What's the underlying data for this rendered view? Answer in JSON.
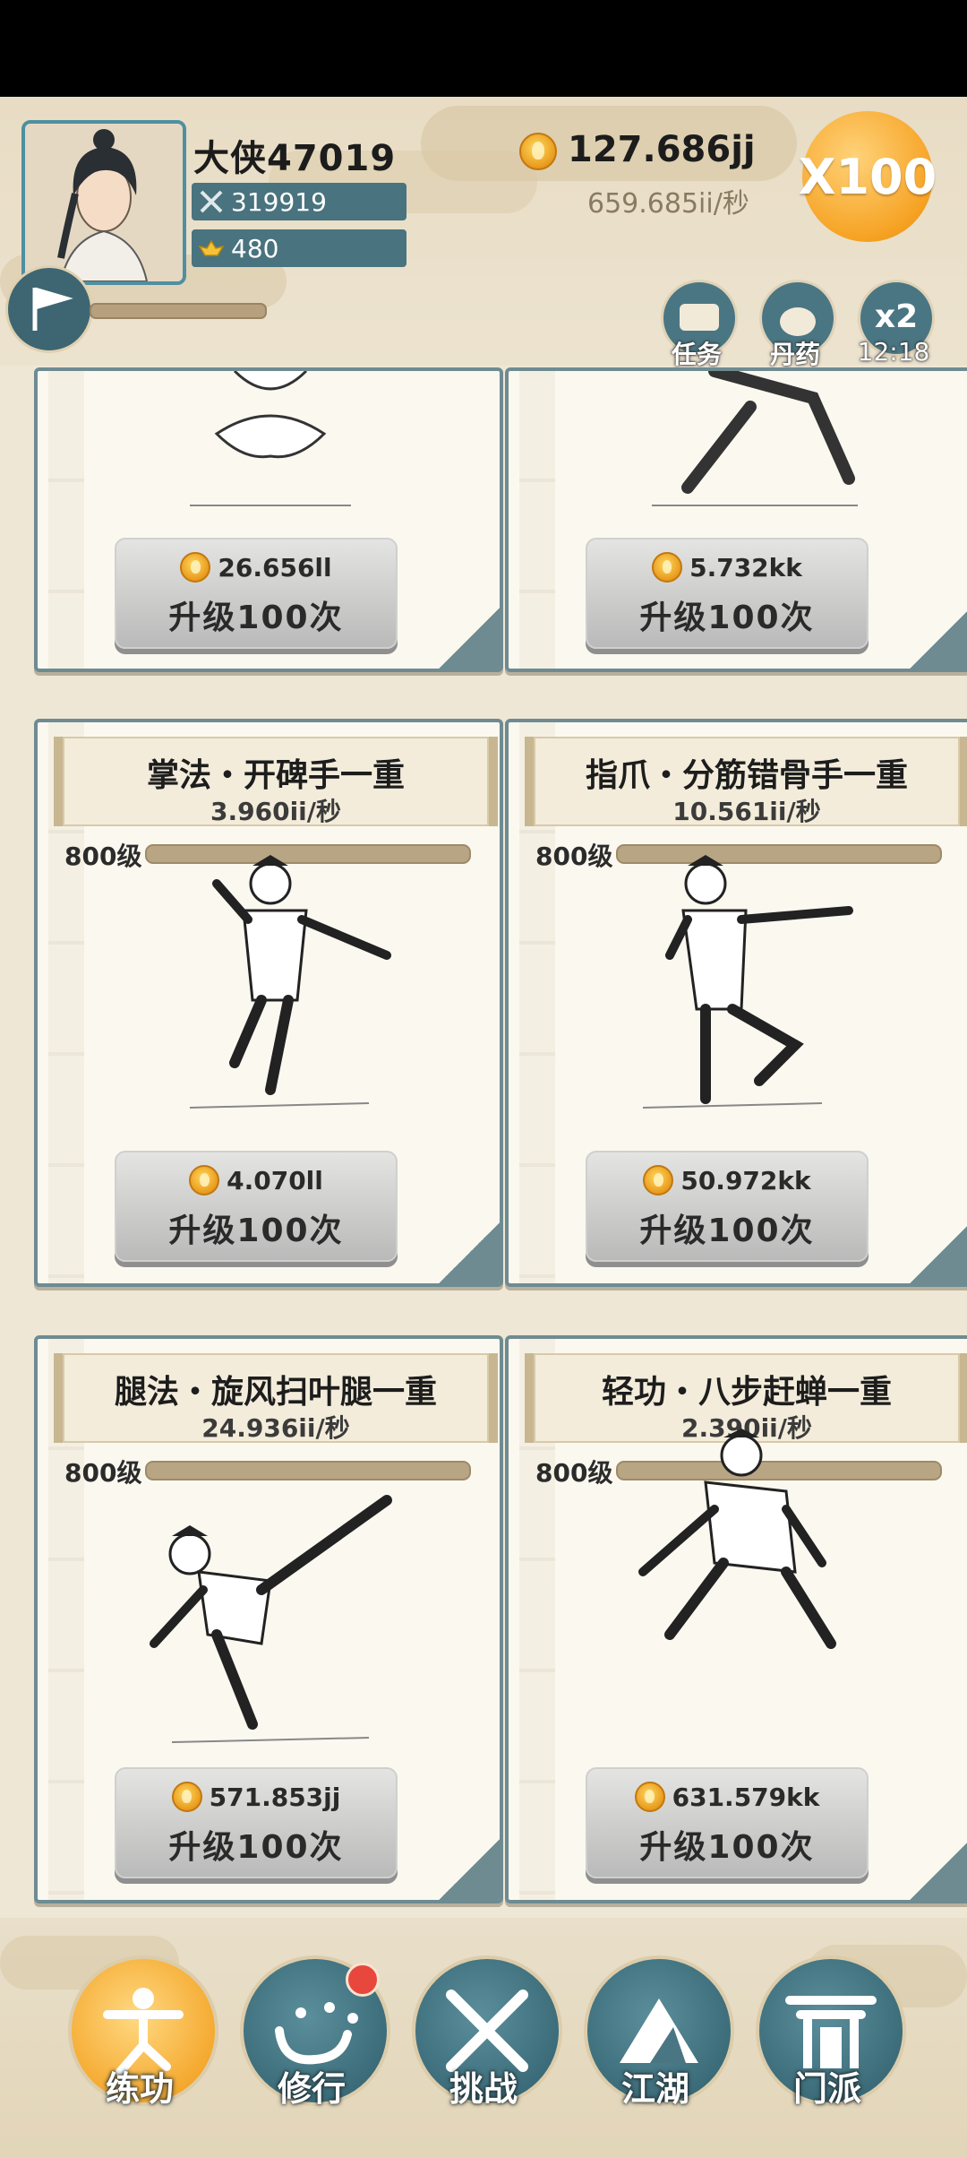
{
  "player": {
    "name": "大侠47019",
    "power": "319919",
    "ingots": "480"
  },
  "currency": {
    "gold": "127.686jj",
    "rate": "659.685ii/秒"
  },
  "multiplier_label": "X100",
  "top_buttons": {
    "tasks": "任务",
    "pills": "丹药",
    "x2": "x2",
    "x2_timer": "12:18"
  },
  "cards": [
    {
      "name": "",
      "rate": "",
      "level": "",
      "cost": "26.656ll",
      "upgrade": "升级100次"
    },
    {
      "name": "",
      "rate": "",
      "level": "",
      "cost": "5.732kk",
      "upgrade": "升级100次"
    },
    {
      "name": "掌法・开碑手一重",
      "rate": "3.960ii/秒",
      "level": "800级",
      "cost": "4.070ll",
      "upgrade": "升级100次"
    },
    {
      "name": "指爪・分筋错骨手一重",
      "rate": "10.561ii/秒",
      "level": "800级",
      "cost": "50.972kk",
      "upgrade": "升级100次"
    },
    {
      "name": "腿法・旋风扫叶腿一重",
      "rate": "24.936ii/秒",
      "level": "800级",
      "cost": "571.853jj",
      "upgrade": "升级100次"
    },
    {
      "name": "轻功・八步赶蝉一重",
      "rate": "2.390ii/秒",
      "level": "800级",
      "cost": "631.579kk",
      "upgrade": "升级100次"
    }
  ],
  "nav": [
    {
      "label": "练功",
      "icon": "martial-pose-icon",
      "active": true
    },
    {
      "label": "修行",
      "icon": "heart-character-icon",
      "active": false
    },
    {
      "label": "挑战",
      "icon": "crossed-swords-icon",
      "active": false
    },
    {
      "label": "江湖",
      "icon": "mountain-icon",
      "active": false
    },
    {
      "label": "门派",
      "icon": "gate-icon",
      "active": false
    }
  ],
  "colors": {
    "accent_teal": "#4a7683",
    "gold": "#f4a62a",
    "paper": "#fbf8f0",
    "badge_red": "#e8473d"
  }
}
